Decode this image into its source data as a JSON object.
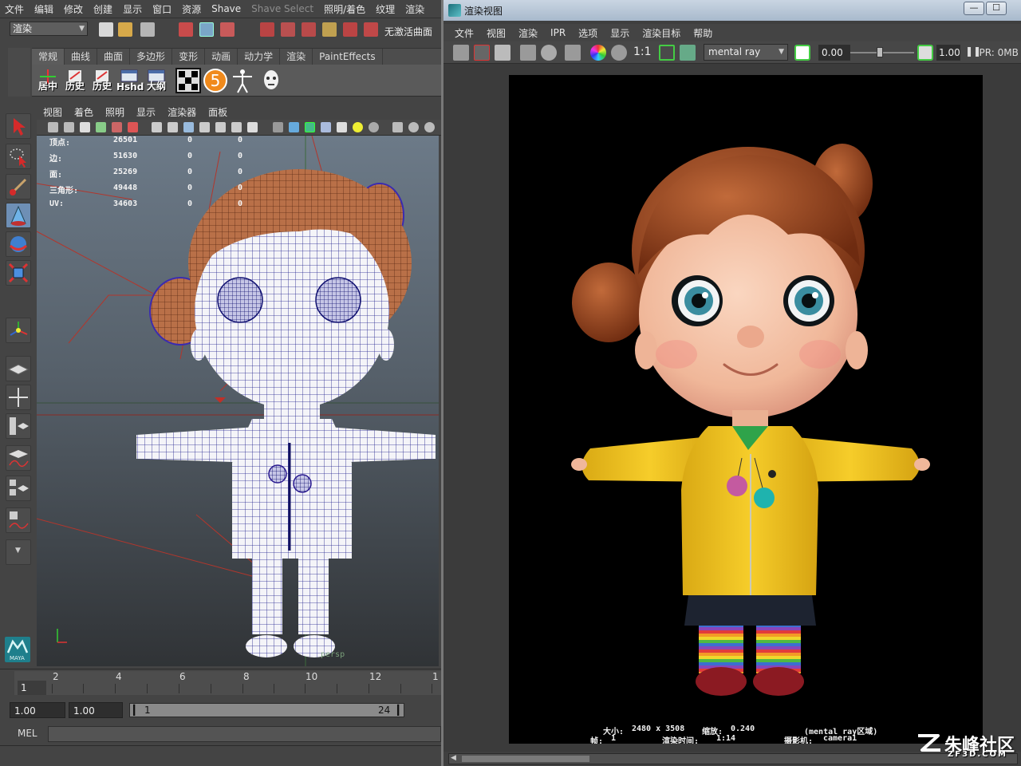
{
  "maya": {
    "menu": [
      "文件",
      "编辑",
      "修改",
      "创建",
      "显示",
      "窗口",
      "资源",
      "Shave",
      "Shave Select",
      "照明/着色",
      "纹理",
      "渲染"
    ],
    "menu_dim": [
      false,
      false,
      false,
      false,
      false,
      false,
      false,
      false,
      true,
      false,
      false,
      false
    ],
    "mode_select": "渲染",
    "no_live_surface": "无激活曲面",
    "shelf_tabs": [
      "常规",
      "曲线",
      "曲面",
      "多边形",
      "变形",
      "动画",
      "动力学",
      "渲染",
      "PaintEffects"
    ],
    "shelf_active_tab": "常规",
    "shelf_buttons": [
      "居中",
      "历史",
      "历史",
      "Hshd",
      "大纲",
      "",
      "5",
      "",
      ""
    ],
    "viewport_menu": [
      "视图",
      "着色",
      "照明",
      "显示",
      "渲染器",
      "面板"
    ],
    "hud": {
      "rows": [
        {
          "label": "顶点:",
          "total": "26501",
          "selected": "0",
          "sel_component": "0"
        },
        {
          "label": "边:",
          "total": "51630",
          "selected": "0",
          "sel_component": "0"
        },
        {
          "label": "面:",
          "total": "25269",
          "selected": "0",
          "sel_component": "0"
        },
        {
          "label": "三角形:",
          "total": "49448",
          "selected": "0",
          "sel_component": "0"
        },
        {
          "label": "UV:",
          "total": "34603",
          "selected": "0",
          "sel_component": "0"
        }
      ]
    },
    "camera_label": "persp",
    "timeline": {
      "current_frame": "1",
      "ticks": [
        "2",
        "4",
        "6",
        "8",
        "10",
        "12",
        "1"
      ]
    },
    "range": {
      "start": "1.00",
      "playback_start": "1.00",
      "slider_start": "1",
      "slider_end": "24"
    },
    "command_label": "MEL",
    "maya_logo": "MAYA"
  },
  "render_view": {
    "title": "渲染视图",
    "menu": [
      "文件",
      "视图",
      "渲染",
      "IPR",
      "选项",
      "显示",
      "渲染目标",
      "帮助"
    ],
    "ratio_label": "1:1",
    "renderer": "mental ray",
    "exposure": "0.00",
    "gamma": "1.00",
    "ipr_memory": "IPR: 0MB",
    "info": {
      "size_label": "大小:",
      "size_value": "2480 x 3508",
      "zoom_label": "缩放:",
      "zoom_value": "0.240",
      "region": "(mental ray区域)",
      "frame_label": "帧:",
      "frame_value": "1",
      "time_label": "渲染时间:",
      "time_value": "1:14",
      "camera_label": "摄影机:",
      "camera_value": "camera1"
    }
  },
  "watermark": {
    "cn": "朱峰社区",
    "en": "ZF3D.COM"
  },
  "colors": {
    "jacket": "#f2c624",
    "hair": "#8a3f1c",
    "skin": "#f3c3a8",
    "wire": "#1c1c8c",
    "ui_bg": "#444444"
  }
}
